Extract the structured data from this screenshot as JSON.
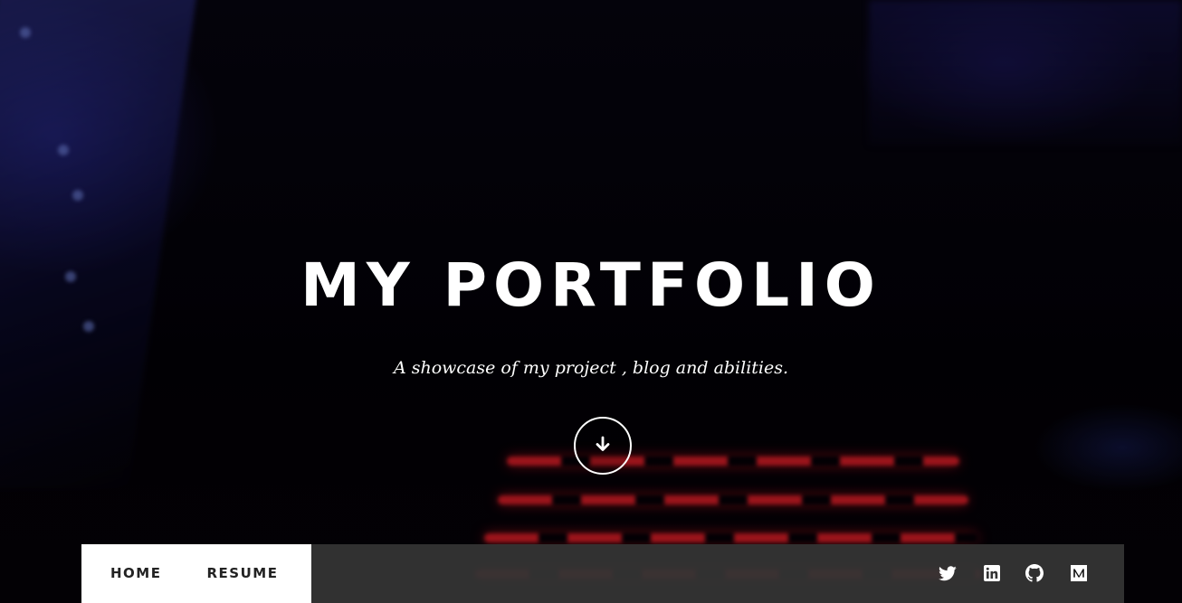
{
  "hero": {
    "title": "MY PORTFOLIO",
    "subtitle": "A showcase of my project , blog and abilities.",
    "scroll_icon": "arrow-down-icon"
  },
  "nav": {
    "links": [
      {
        "label": "HOME"
      },
      {
        "label": "RESUME"
      }
    ],
    "social": [
      {
        "icon": "twitter-icon"
      },
      {
        "icon": "linkedin-icon"
      },
      {
        "icon": "github-icon"
      },
      {
        "icon": "medium-icon"
      }
    ]
  },
  "colors": {
    "text": "#ffffff",
    "nav_bg": "#343434",
    "nav_active_bg": "#ffffff",
    "nav_link": "#222222",
    "keyboard_glow": "#e61e28"
  }
}
